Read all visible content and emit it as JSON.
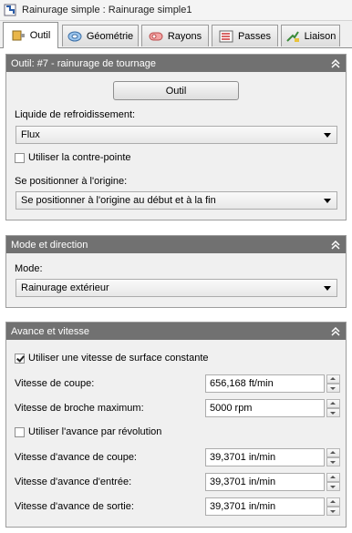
{
  "window": {
    "title": "Rainurage simple : Rainurage simple1"
  },
  "tabs": [
    {
      "label": "Outil",
      "icon": "tool-icon",
      "active": true
    },
    {
      "label": "Géométrie",
      "icon": "geometry-icon",
      "active": false
    },
    {
      "label": "Rayons",
      "icon": "radii-icon",
      "active": false
    },
    {
      "label": "Passes",
      "icon": "passes-icon",
      "active": false
    },
    {
      "label": "Liaison",
      "icon": "linking-icon",
      "active": false
    }
  ],
  "outil_panel": {
    "header": "Outil: #7 - rainurage de tournage",
    "tool_button": "Outil",
    "coolant_label": "Liquide de refroidissement:",
    "coolant_value": "Flux",
    "tailstock_label": "Utiliser la contre-pointe",
    "tailstock_checked": false,
    "home_label": "Se positionner à l'origine:",
    "home_value": "Se positionner à l'origine au début et à la fin"
  },
  "mode_panel": {
    "header": "Mode et direction",
    "mode_label": "Mode:",
    "mode_value": "Rainurage extérieur"
  },
  "feed_panel": {
    "header": "Avance et vitesse",
    "css_label": "Utiliser une vitesse de surface constante",
    "css_checked": true,
    "cutting_speed_label": "Vitesse de coupe:",
    "cutting_speed_value": "656,168 ft/min",
    "max_spindle_label": "Vitesse de broche maximum:",
    "max_spindle_value": "5000 rpm",
    "feed_per_rev_label": "Utiliser l'avance par révolution",
    "feed_per_rev_checked": false,
    "cutting_feed_label": "Vitesse d'avance de coupe:",
    "cutting_feed_value": "39,3701 in/min",
    "lead_in_label": "Vitesse d'avance d'entrée:",
    "lead_in_value": "39,3701 in/min",
    "lead_out_label": "Vitesse d'avance de sortie:",
    "lead_out_value": "39,3701 in/min"
  }
}
